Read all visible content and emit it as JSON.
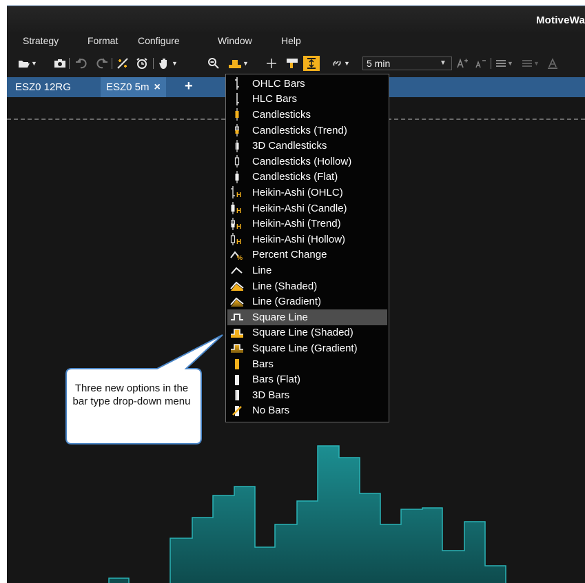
{
  "window": {
    "title": "MotiveWa"
  },
  "menubar": {
    "items": [
      "Strategy",
      "Format",
      "Configure",
      "Window",
      "Help"
    ]
  },
  "toolbar": {
    "timeframe": "5 min",
    "icons": [
      "open-folder-icon",
      "camera-icon",
      "undo-icon",
      "redo-icon",
      "study-icon",
      "alarm-icon",
      "hand-icon",
      "zoom-icon",
      "bar-type-icon",
      "crosshair-icon",
      "ruler-icon",
      "scale-icon",
      "link-icon",
      "font-increase-icon",
      "font-decrease-icon",
      "align-icon",
      "list-icon"
    ]
  },
  "tabs": {
    "items": [
      {
        "label": "ESZ0 12RG"
      },
      {
        "label": "ESZ0 5m",
        "close": "×"
      }
    ],
    "add_label": "+"
  },
  "bar_type_menu": {
    "options": [
      {
        "label": "OHLC Bars",
        "icon": "ohlc-bar-icon"
      },
      {
        "label": "HLC Bars",
        "icon": "hlc-bar-icon"
      },
      {
        "label": "Candlesticks",
        "icon": "candlestick-icon"
      },
      {
        "label": "Candlesticks (Trend)",
        "icon": "candlestick-trend-icon"
      },
      {
        "label": "3D Candlesticks",
        "icon": "candlestick-3d-icon"
      },
      {
        "label": "Candlesticks (Hollow)",
        "icon": "candlestick-hollow-icon"
      },
      {
        "label": "Candlesticks (Flat)",
        "icon": "candlestick-flat-icon"
      },
      {
        "label": "Heikin-Ashi (OHLC)",
        "icon": "heikin-ashi-ohlc-icon"
      },
      {
        "label": "Heikin-Ashi (Candle)",
        "icon": "heikin-ashi-candle-icon"
      },
      {
        "label": "Heikin-Ashi (Trend)",
        "icon": "heikin-ashi-trend-icon"
      },
      {
        "label": "Heikin-Ashi (Hollow)",
        "icon": "heikin-ashi-hollow-icon"
      },
      {
        "label": "Percent Change",
        "icon": "percent-change-icon"
      },
      {
        "label": "Line",
        "icon": "line-icon"
      },
      {
        "label": "Line (Shaded)",
        "icon": "line-shaded-icon"
      },
      {
        "label": "Line (Gradient)",
        "icon": "line-gradient-icon"
      },
      {
        "label": "Square Line",
        "icon": "square-line-icon",
        "selected": true
      },
      {
        "label": "Square Line (Shaded)",
        "icon": "square-line-shaded-icon"
      },
      {
        "label": "Square Line (Gradient)",
        "icon": "square-line-gradient-icon"
      },
      {
        "label": "Bars",
        "icon": "bars-icon"
      },
      {
        "label": "Bars (Flat)",
        "icon": "bars-flat-icon"
      },
      {
        "label": "3D Bars",
        "icon": "bars-3d-icon"
      },
      {
        "label": "No Bars",
        "icon": "no-bars-icon"
      }
    ]
  },
  "callout": {
    "text": "Three new options in the bar type drop-down menu"
  },
  "colors": {
    "chart_fill_top": "#1c8f92",
    "chart_fill_bottom": "#0e4b4d",
    "chart_line": "#2ab3b6",
    "tab_bar": "#2e5d8e",
    "tab_active": "#3f73a8",
    "menu_bg": "#050505",
    "menu_selected": "#4d4d4d",
    "icon_accent": "#f3b01c",
    "callout_fill": "#ffffff",
    "callout_border": "#4a86c8"
  }
}
